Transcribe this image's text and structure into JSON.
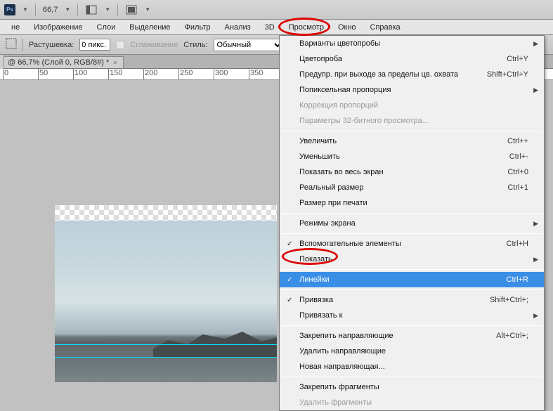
{
  "topbar": {
    "zoom": "66,7",
    "ps_label": "Ps"
  },
  "menubar": {
    "items": [
      "не",
      "Изображение",
      "Слои",
      "Выделение",
      "Фильтр",
      "Анализ",
      "3D",
      "Просмотр",
      "Окно",
      "Справка"
    ]
  },
  "optbar": {
    "feather_label": "Растушевка:",
    "feather_value": "0 пикс.",
    "antialias_label": "Сглаживание",
    "style_label": "Стиль:",
    "style_value": "Обычный"
  },
  "tab": {
    "title": "@ 66,7% (Слой 0, RGB/8#) *",
    "close": "×"
  },
  "ruler": {
    "ticks": [
      "0",
      "50",
      "100",
      "150",
      "200",
      "250",
      "300",
      "350"
    ]
  },
  "menu": {
    "items": [
      {
        "label": "Варианты цветопробы",
        "arrow": true
      },
      {
        "label": "Цветопроба",
        "shortcut": "Ctrl+Y"
      },
      {
        "label": "Предупр. при выходе за пределы цв. охвата",
        "shortcut": "Shift+Ctrl+Y"
      },
      {
        "label": "Попиксельная пропорция",
        "arrow": true
      },
      {
        "label": "Коррекция пропорций",
        "disabled": true
      },
      {
        "label": "Параметры 32-битного просмотра...",
        "disabled": true
      },
      {
        "sep": true
      },
      {
        "label": "Увеличить",
        "shortcut": "Ctrl++"
      },
      {
        "label": "Уменьшить",
        "shortcut": "Ctrl+-"
      },
      {
        "label": "Показать во весь экран",
        "shortcut": "Ctrl+0"
      },
      {
        "label": "Реальный размер",
        "shortcut": "Ctrl+1"
      },
      {
        "label": "Размер при печати"
      },
      {
        "sep": true
      },
      {
        "label": "Режимы экрана",
        "arrow": true
      },
      {
        "sep": true
      },
      {
        "label": "Вспомогательные элементы",
        "shortcut": "Ctrl+H",
        "check": true
      },
      {
        "label": "Показать",
        "arrow": true
      },
      {
        "sep": true
      },
      {
        "label": "Линейки",
        "shortcut": "Ctrl+R",
        "check": true,
        "selected": true
      },
      {
        "sep": true
      },
      {
        "label": "Привязка",
        "shortcut": "Shift+Ctrl+;",
        "check": true
      },
      {
        "label": "Привязать к",
        "arrow": true
      },
      {
        "sep": true
      },
      {
        "label": "Закрепить направляющие",
        "shortcut": "Alt+Ctrl+;"
      },
      {
        "label": "Удалить направляющие"
      },
      {
        "label": "Новая направляющая..."
      },
      {
        "sep": true
      },
      {
        "label": "Закрепить фрагменты"
      },
      {
        "label": "Удалить фрагменты",
        "disabled": true
      }
    ]
  }
}
